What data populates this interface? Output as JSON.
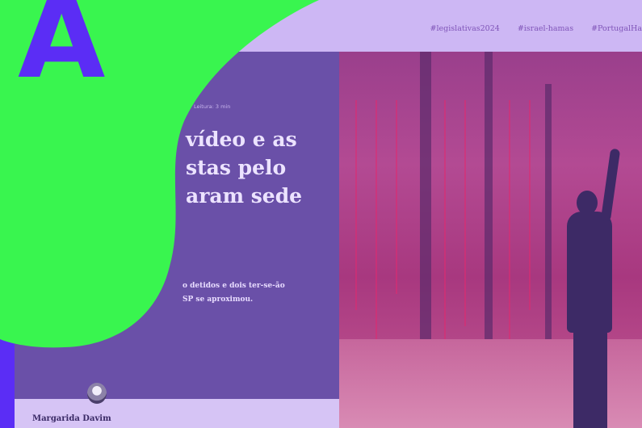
{
  "site": {
    "trending_tags": [
      "#legislativas2024",
      "#israel-hamas",
      "#PortugalHa"
    ],
    "article": {
      "meta": "Leitura: 3 min",
      "headline_lines": [
        "vídeo e as",
        "stas pelo",
        "aram sede"
      ],
      "lede_lines": [
        "o detidos e dois ter-se-ão",
        "SP se aproximou."
      ],
      "author": "Margarida Davim"
    }
  },
  "brand": {
    "logo_letter": "A",
    "colors": {
      "background": "#5b2df5",
      "blob": "#39f54f",
      "panel": "#6a50a8"
    }
  }
}
